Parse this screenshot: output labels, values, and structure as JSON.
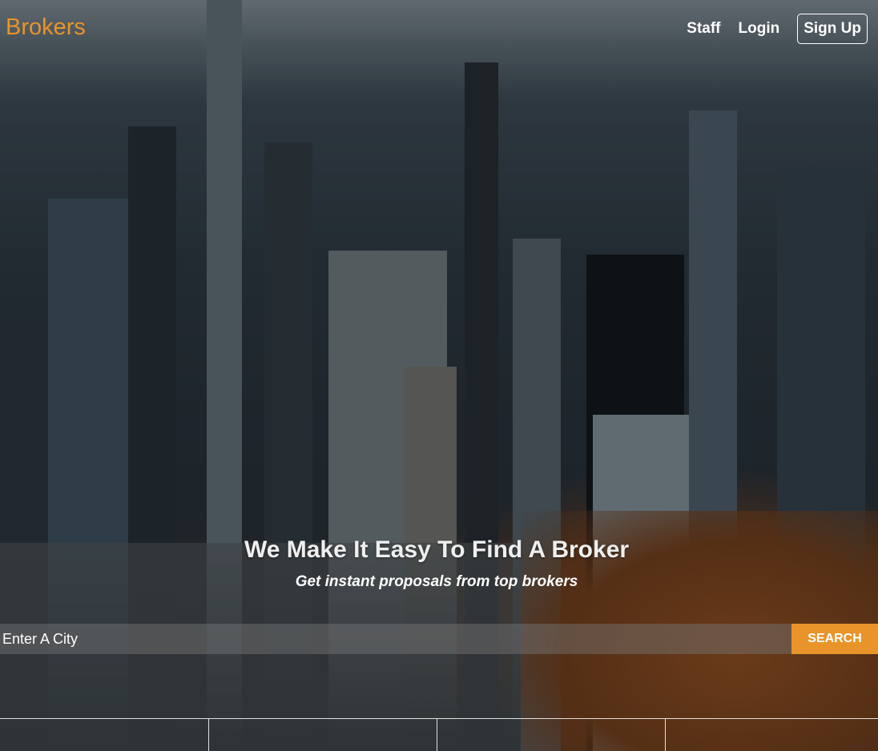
{
  "brand": {
    "name": "Brokers",
    "color": "#e8942a"
  },
  "nav": {
    "staff_label": "Staff",
    "login_label": "Login",
    "signup_label": "Sign Up"
  },
  "hero": {
    "headline": "We Make It Easy To Find A Broker",
    "subheadline": "Get instant proposals from top brokers",
    "background_icon": "city-skyline-photo"
  },
  "search": {
    "placeholder": "Enter A City",
    "button_label": "SEARCH",
    "accent": "#e8942a"
  }
}
